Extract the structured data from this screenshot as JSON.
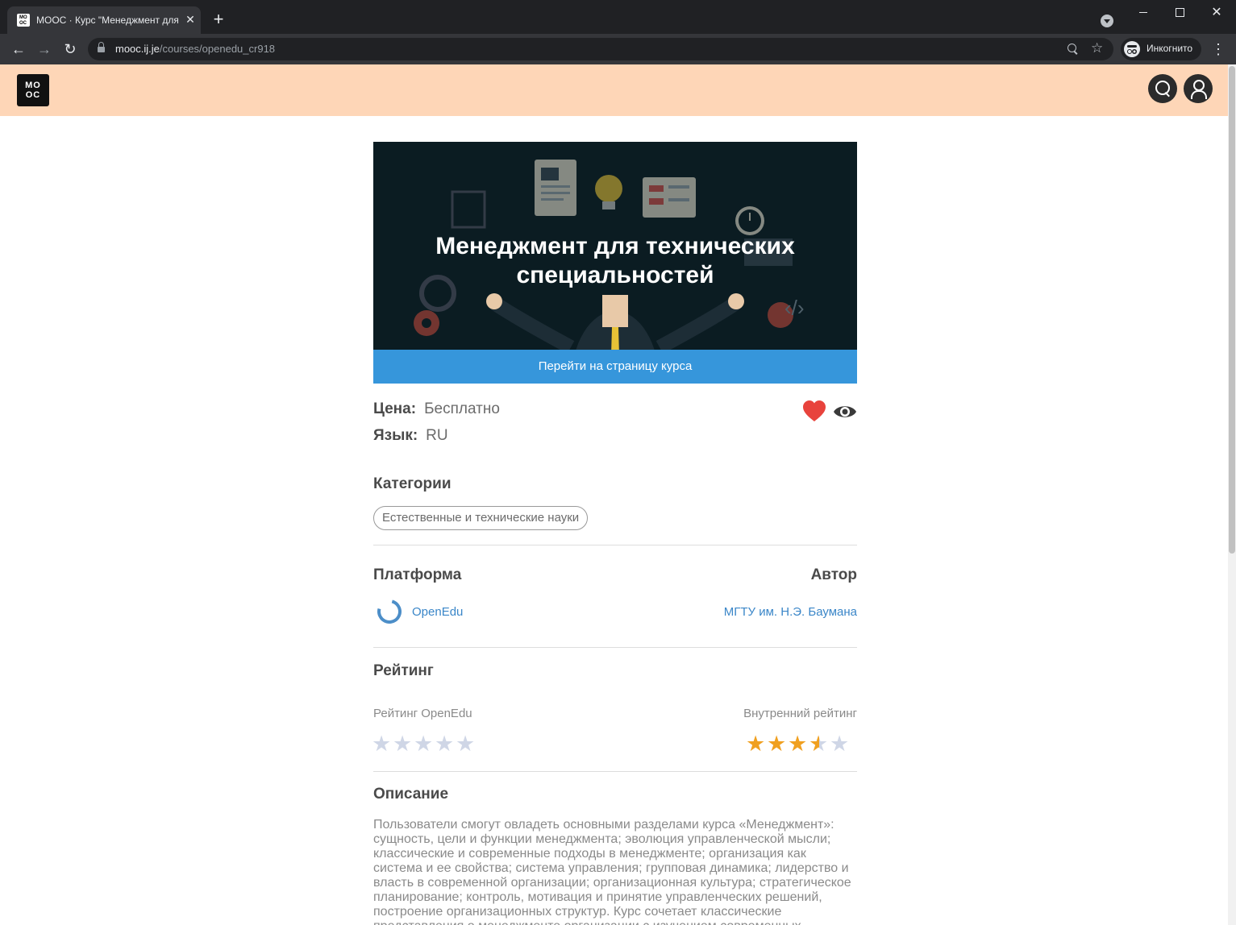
{
  "browser": {
    "tab_title": "MOOC · Курс \"Менеджмент для",
    "favicon_text": [
      "MO",
      "OC"
    ],
    "url_host": "mooc.ij.je",
    "url_path": "/courses/openedu_cr918",
    "incognito_label": "Инкогнито"
  },
  "site": {
    "logo_lines": [
      "MO",
      "OC"
    ]
  },
  "course": {
    "title": "Менеджмент для технических специальностей",
    "goto_button": "Перейти на страницу курса",
    "price_label": "Цена:",
    "price_value": "Бесплатно",
    "language_label": "Язык:",
    "language_value": "RU",
    "categories_heading": "Категории",
    "categories": [
      "Естественные и технические науки"
    ],
    "platform_heading": "Платформа",
    "platform_name": "OpenEdu",
    "author_heading": "Автор",
    "author_name": "МГТУ им. Н.Э. Баумана",
    "rating_heading": "Рейтинг",
    "platform_rating_label": "Рейтинг OpenEdu",
    "platform_rating_value": 0,
    "internal_rating_label": "Внутренний рейтинг",
    "internal_rating_value": 3.5,
    "rating_max": 5,
    "description_heading": "Описание",
    "description": "Пользователи смогут овладеть основными разделами курса «Менеджмент»: сущность, цели и функции менеджмента; эволюция управленческой мысли; классические и современные подходы в менеджменте; организация как система и ее свойства; система управления; групповая динамика; лидерство и власть в современной организации; организационная культура; стратегическое планирование; контроль, мотивация и принятие управленческих решений, построение организационных структур. Курс сочетает классические представления о менеджменте организации с изучением современных"
  },
  "colors": {
    "header_bg": "#fed6b7",
    "accent": "#3696db",
    "heart": "#e8433c",
    "star_on": "#f0a020",
    "star_off": "#cfd6e6"
  }
}
